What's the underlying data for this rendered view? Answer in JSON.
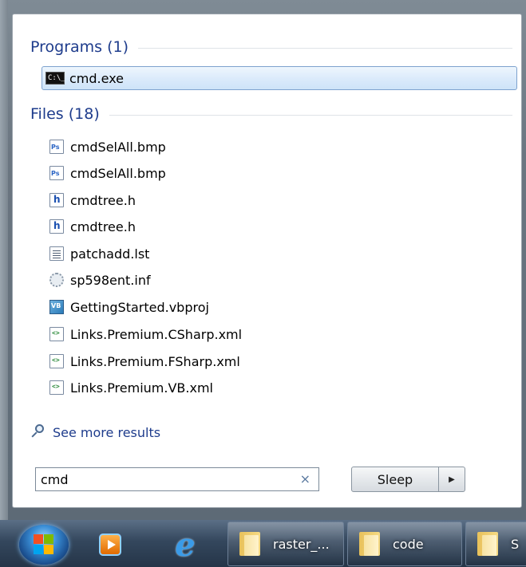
{
  "programs": {
    "header": "Programs (1)",
    "items": [
      {
        "label": "cmd.exe",
        "icon": "cmd-icon",
        "selected": true
      }
    ]
  },
  "files": {
    "header": "Files (18)",
    "items": [
      {
        "label": "cmdSelAll.bmp",
        "icon": "photoshop-file-icon"
      },
      {
        "label": "cmdSelAll.bmp",
        "icon": "photoshop-file-icon"
      },
      {
        "label": "cmdtree.h",
        "icon": "header-file-icon"
      },
      {
        "label": "cmdtree.h",
        "icon": "header-file-icon"
      },
      {
        "label": "patchadd.lst",
        "icon": "text-file-icon"
      },
      {
        "label": "sp598ent.inf",
        "icon": "settings-file-icon"
      },
      {
        "label": "GettingStarted.vbproj",
        "icon": "vb-project-icon"
      },
      {
        "label": "Links.Premium.CSharp.xml",
        "icon": "xml-file-icon"
      },
      {
        "label": "Links.Premium.FSharp.xml",
        "icon": "xml-file-icon"
      },
      {
        "label": "Links.Premium.VB.xml",
        "icon": "xml-file-icon"
      }
    ]
  },
  "see_more": "See more results",
  "search": {
    "value": "cmd",
    "clear_icon": "×"
  },
  "power": {
    "label": "Sleep",
    "arrow": "▶"
  },
  "taskbar": {
    "start": "start-orb-icon",
    "pinned": [
      "media-center-icon",
      "internet-explorer-icon"
    ],
    "buttons": [
      {
        "label": "raster_...",
        "icon": "folder-icon"
      },
      {
        "label": "code",
        "icon": "folder-icon"
      },
      {
        "label": "S",
        "icon": "folder-icon"
      }
    ]
  },
  "colors": {
    "accent": "#1e3c8c",
    "selection": "#cde3f8",
    "taskbar": "#34475d"
  }
}
